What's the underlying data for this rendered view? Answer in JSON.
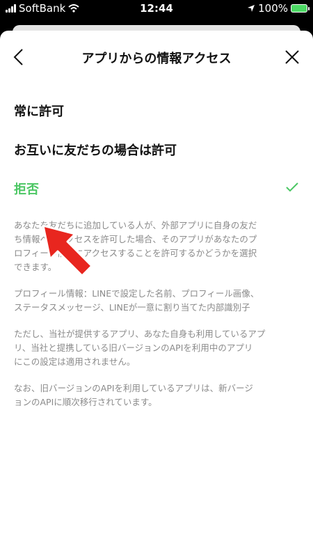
{
  "status_bar": {
    "carrier": "SoftBank",
    "time": "12:44",
    "battery": "100%"
  },
  "header": {
    "title": "アプリからの情報アクセス"
  },
  "options": [
    {
      "label": "常に許可",
      "selected": false
    },
    {
      "label": "お互いに友だちの場合は許可",
      "selected": false
    },
    {
      "label": "拒否",
      "selected": true
    }
  ],
  "description": {
    "para1_line1": "あなたを友だちに追加している人が、外部アプリに自身の友だ",
    "para1_line2": "ち情報へのアクセスを許可した場合、そのアプリがあなたのプ",
    "para1_line3": "ロフィール情報にアクセスすることを許可するかどうかを選択",
    "para1_line4": "できます。",
    "para2_line1": "プロフィール情報：LINEで設定した名前、プロフィール画像、",
    "para2_line2": "ステータスメッセージ、LINEが一意に割り当てた内部識別子",
    "para3_line1": "ただし、当社が提供するアプリ、あなた自身も利用しているアプ",
    "para3_line2": "リ、当社と提携している旧バージョンのAPIを利用中のアプリ",
    "para3_line3": "にこの設定は適用されません。",
    "para4_line1": "なお、旧バージョンのAPIを利用しているアプリは、新バージ",
    "para4_line2": "ョンのAPIに順次移行されています。"
  },
  "colors": {
    "accent": "#4cc764",
    "annotation": "#e8261f"
  },
  "icons": {
    "back": "chevron-left-icon",
    "close": "close-icon",
    "check": "check-icon"
  }
}
